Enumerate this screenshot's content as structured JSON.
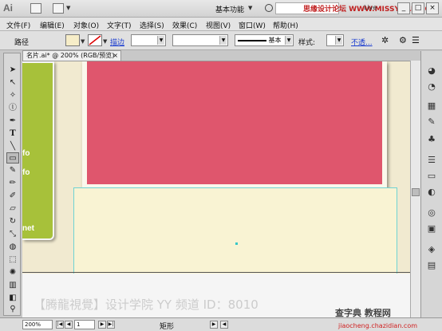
{
  "titlebar": {
    "app_logo": "Ai",
    "workspace_label": "基本功能",
    "watermark": "思缘设计论坛 WWW.MISSYUAN.COM",
    "live_label": "Live",
    "minimize": "_",
    "maximize": "□",
    "close": "×"
  },
  "menu": {
    "items": [
      "文件(F)",
      "编辑(E)",
      "对象(O)",
      "文字(T)",
      "选择(S)",
      "效果(C)",
      "视图(V)",
      "窗口(W)",
      "帮助(H)"
    ]
  },
  "control": {
    "object_type": "路径",
    "stroke_label": "描边",
    "stroke_style": "基本",
    "style_label": "样式:",
    "opacity_label": "不透..."
  },
  "colors": {
    "fill_swatch": "#f6edc8",
    "green_panel": "#a7c13a",
    "pink_card": "#df566d",
    "selection": "#6fd3d3",
    "canvas": "#f1ead0"
  },
  "document": {
    "tab_title": "名片.ai* @ 200% (RGB/预览)",
    "tab_close": "×"
  },
  "canvas": {
    "green_texts": [
      "fo",
      "fo",
      "net"
    ],
    "watermark": "【腾龍視覺】设计学院 YY 频道 ID：8010"
  },
  "status": {
    "zoom": "200%",
    "page": "1",
    "tool_name": "矩形"
  },
  "footer": {
    "site_name": "查字典 教程网",
    "site_url": "jiaocheng.chazidian.com"
  },
  "tools": [
    "selection-tool",
    "direct-selection-tool",
    "magic-wand-tool",
    "pen-tool",
    "type-tool",
    "line-tool",
    "rectangle-tool",
    "paintbrush-tool",
    "pencil-tool",
    "blob-brush-tool",
    "eraser-tool",
    "rotate-tool",
    "scale-tool",
    "warp-tool",
    "free-transform-tool",
    "symbol-sprayer-tool",
    "graph-tool",
    "mesh-tool",
    "gradient-tool",
    "eyedropper-tool",
    "blend-tool",
    "live-paint-tool",
    "slice-tool",
    "hand-tool",
    "zoom-tool"
  ],
  "panel_icons": [
    "color-guide-icon",
    "color-icon",
    "swatches-icon",
    "brushes-icon",
    "symbols-icon",
    "stroke-icon",
    "gradient-icon",
    "transparency-icon",
    "appearance-icon",
    "graphic-styles-icon",
    "layers-icon",
    "artboards-icon"
  ]
}
